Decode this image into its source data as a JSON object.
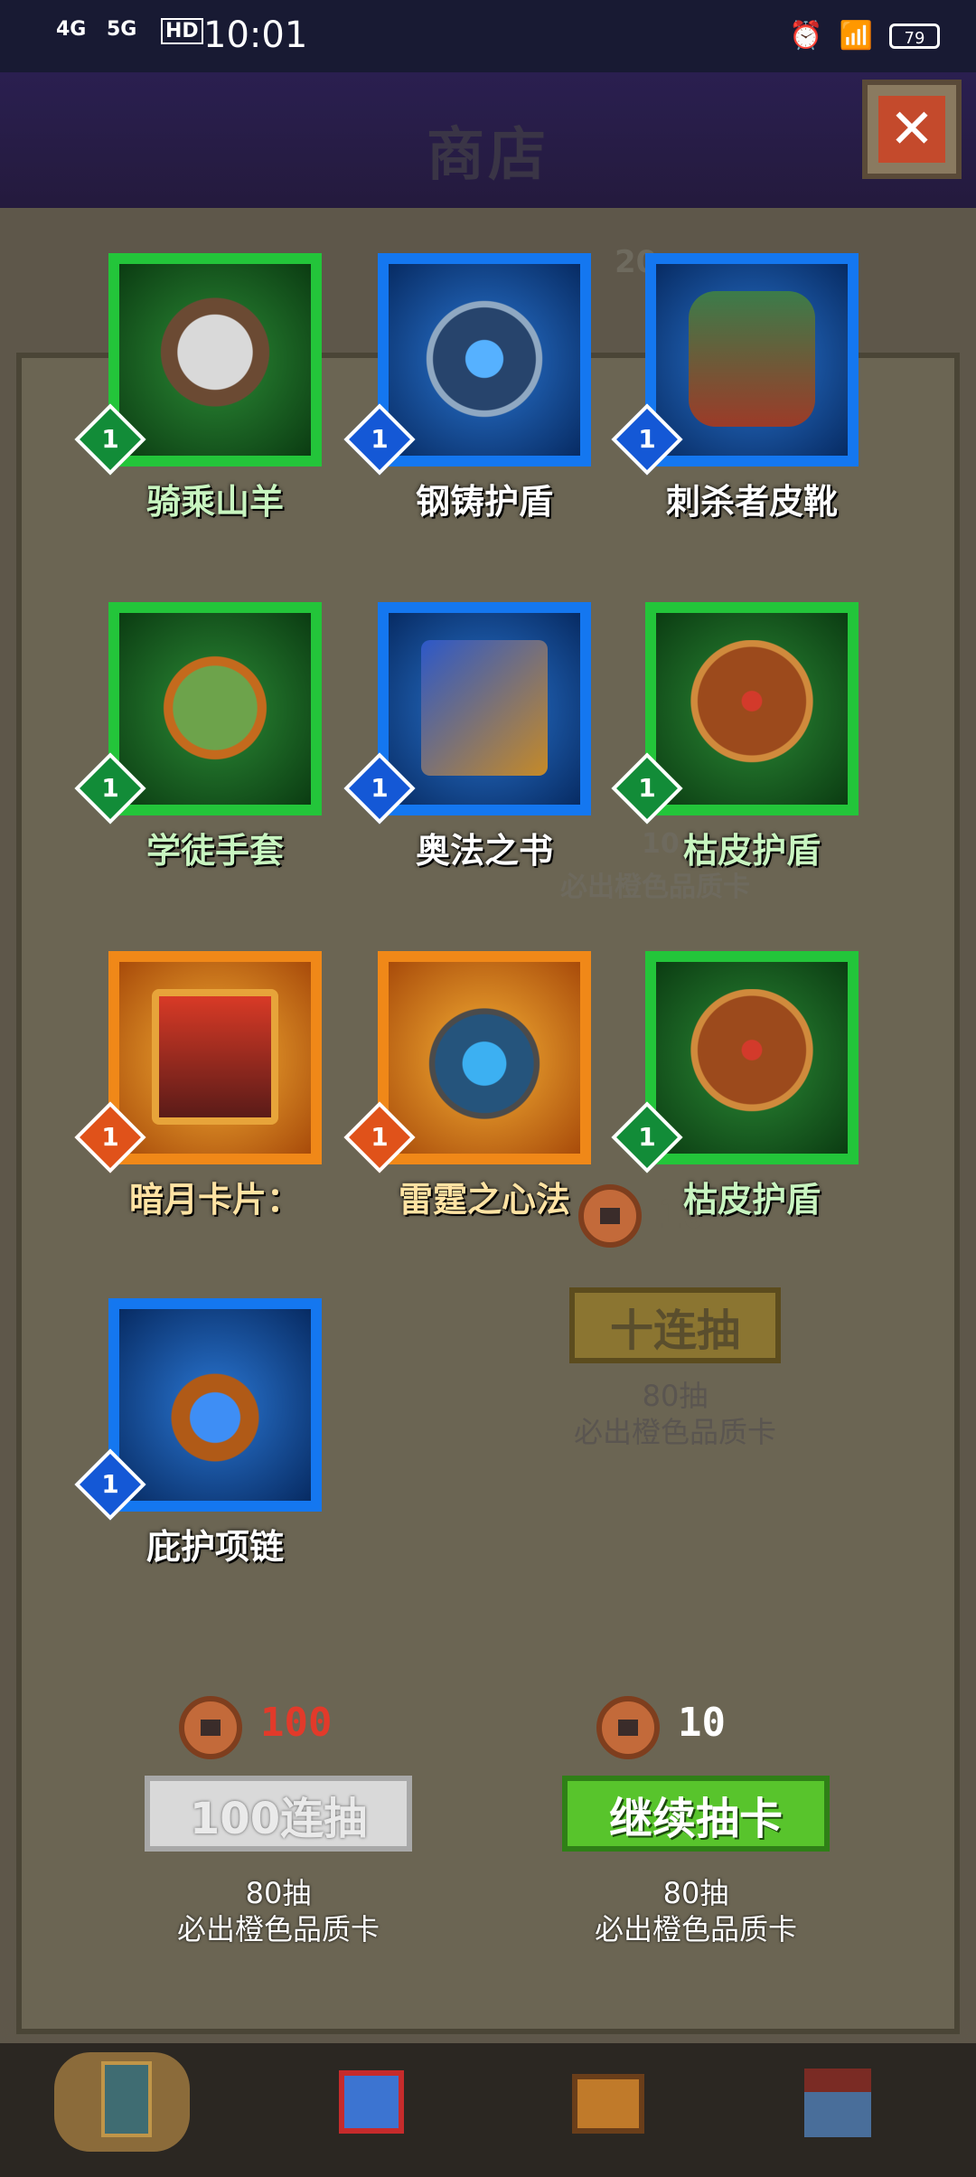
{
  "status_bar": {
    "signal_1": "4G",
    "signal_2": "5G",
    "hd": "HD",
    "time": "10:01",
    "battery": "79"
  },
  "header": {
    "title": "商店",
    "close_label": "✕"
  },
  "cards": [
    {
      "name": "骑乘山羊",
      "level": "1",
      "rarity": "green",
      "icon": "goat-icon"
    },
    {
      "name": "钢铸护盾",
      "level": "1",
      "rarity": "blue",
      "icon": "shield-icon"
    },
    {
      "name": "刺杀者皮靴",
      "level": "1",
      "rarity": "blue",
      "icon": "boots-icon"
    },
    {
      "name": "学徒手套",
      "level": "1",
      "rarity": "green",
      "icon": "glove-icon"
    },
    {
      "name": "奥法之书",
      "level": "1",
      "rarity": "blue",
      "icon": "book-icon"
    },
    {
      "name": "枯皮护盾",
      "level": "1",
      "rarity": "green",
      "icon": "bark-shield-icon"
    },
    {
      "name": "暗月卡片：",
      "level": "1",
      "rarity": "orange",
      "icon": "volcano-card-icon"
    },
    {
      "name": "雷霆之心法",
      "level": "1",
      "rarity": "orange",
      "icon": "thunder-heart-icon"
    },
    {
      "name": "枯皮护盾",
      "level": "1",
      "rarity": "green",
      "icon": "bark-shield-icon"
    },
    {
      "name": "庇护项链",
      "level": "1",
      "rarity": "blue",
      "icon": "necklace-icon"
    }
  ],
  "background": {
    "counter_partial": "20",
    "note_1_partial": "10",
    "note_1_line2": "必出橙色品质卡",
    "cost_behind": "10",
    "ten_draw_label": "十连抽",
    "ten_note_line1": "80抽",
    "ten_note_line2": "必出橙色品质卡"
  },
  "draw_100": {
    "cost": "100",
    "label": "100连抽",
    "note_line1": "80抽",
    "note_line2": "必出橙色品质卡"
  },
  "draw_continue": {
    "cost": "10",
    "label": "继续抽卡",
    "note_line1": "80抽",
    "note_line2": "必出橙色品质卡"
  },
  "colors": {
    "green": "#23c53a",
    "blue": "#1477f0",
    "orange": "#f08818",
    "cost_red": "#e23a2a"
  },
  "nav": [
    {
      "icon": "card-deck-icon"
    },
    {
      "icon": "gift-icon"
    },
    {
      "icon": "treasure-chest-icon"
    },
    {
      "icon": "house-icon"
    }
  ]
}
